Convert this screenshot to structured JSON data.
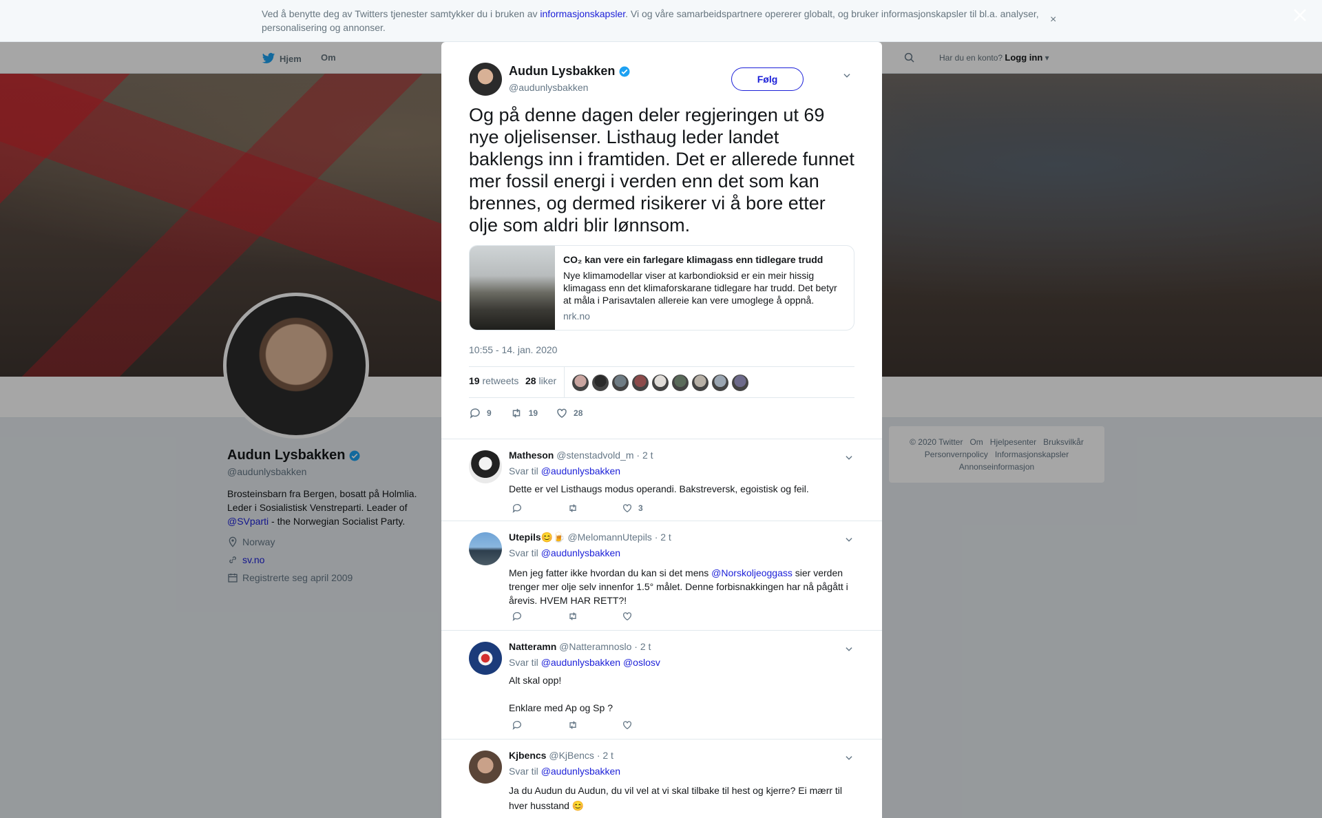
{
  "cookie_banner": {
    "text_before": "Ved å benytte deg av Twitters tjenester samtykker du i bruken av ",
    "link": "informasjonskapsler",
    "text_after": ". Vi og våre samarbeidspartnere opererer globalt, og bruker informasjonskapsler til bl.a. analyser, personalisering og annonser.",
    "close": "×"
  },
  "nav": {
    "home": "Hjem",
    "about": "Om",
    "account_question": "Har du en konto?",
    "login": "Logg inn"
  },
  "profile": {
    "name": "Audun Lysbakken",
    "handle": "@audunlysbakken",
    "bio_1": "Brosteinsbarn fra Bergen, bosatt på Holmlia. Leder i Sosialistisk Venstreparti. Leader of ",
    "bio_link": "@SVparti",
    "bio_2": " - the Norwegian Socialist Party.",
    "location": "Norway",
    "website": "sv.no",
    "joined": "Registrerte seg april 2009"
  },
  "footer": {
    "items": [
      "© 2020 Twitter",
      "Om",
      "Hjelpesenter",
      "Bruksvilkår",
      "Personvernpolicy",
      "Informasjonskapsler",
      "Annonseinformasjon"
    ]
  },
  "tweet": {
    "name": "Audun Lysbakken",
    "handle": "@audunlysbakken",
    "follow_label": "Følg",
    "text": "Og på denne dagen deler regjeringen ut 69 nye oljelisenser. Listhaug leder landet baklengs inn i framtiden. Det er allerede funnet mer fossil energi i verden enn det som kan brennes, og dermed risikerer vi å bore etter olje som aldri blir lønnsom.",
    "card": {
      "title": "CO₂ kan vere ein farlegare klimagass enn tidlegare trudd",
      "description": "Nye klimamodellar viser at karbondioksid er ein meir hissig klimagass enn det klimaforskarane tidlegare har trudd. Det betyr at måla i Parisavtalen allereie kan vere umoglege å oppnå.",
      "domain": "nrk.no"
    },
    "timestamp": "10:55 - 14. jan. 2020",
    "retweets_count": "19",
    "retweets_label": "retweets",
    "likes_count": "28",
    "likes_label": "liker",
    "reply_count": "9",
    "retweet_count": "19",
    "like_count": "28"
  },
  "likers": [
    "#c9a5a0",
    "#2b2b2b",
    "#6f7c84",
    "#8c4b4b",
    "#e0dcd8",
    "#5a6a5a",
    "#b7b0a6",
    "#9aa5b1",
    "#6d6a8a"
  ],
  "replies": [
    {
      "name": "Matheson",
      "handle": "@stenstadvold_m",
      "time": "· 2 t",
      "reply_to_label": "Svar til ",
      "reply_to": "@audunlysbakken",
      "text": "Dette er vel Listhaugs modus operandi. Bakstreversk, egoistisk og feil.",
      "likes": "3"
    },
    {
      "name": "Utepils😊🍺",
      "handle": "@MelomannUtepils",
      "time": "· 2 t",
      "reply_to_label": "Svar til ",
      "reply_to": "@audunlysbakken",
      "text_1": "Men jeg fatter ikke hvordan du kan si det mens ",
      "mention": "@Norskoljeoggass",
      "text_2": " sier verden trenger mer olje selv innenfor 1.5° målet. Denne forbisnakkingen har nå pågått i årevis. HVEM HAR RETT?!"
    },
    {
      "name": "Natteramn",
      "handle": "@Natteramnoslo",
      "time": "· 2 t",
      "reply_to_label": "Svar til ",
      "reply_to": "@audunlysbakken @oslosv",
      "text_1": "Alt skal opp!",
      "text_2": "Enklare med Ap og Sp  ?"
    },
    {
      "name": "Kjbencs",
      "handle": "@KjBencs",
      "time": "· 2 t",
      "reply_to_label": "Svar til ",
      "reply_to": "@audunlysbakken",
      "text": "Ja du Audun du Audun, du vil vel at vi skal tilbake til hest og kjerre? Ei mærr til hver husstand 😊"
    }
  ],
  "colors": {
    "link": "#1b1fd8",
    "verified": "#1da1f2",
    "muted": "#657786"
  }
}
